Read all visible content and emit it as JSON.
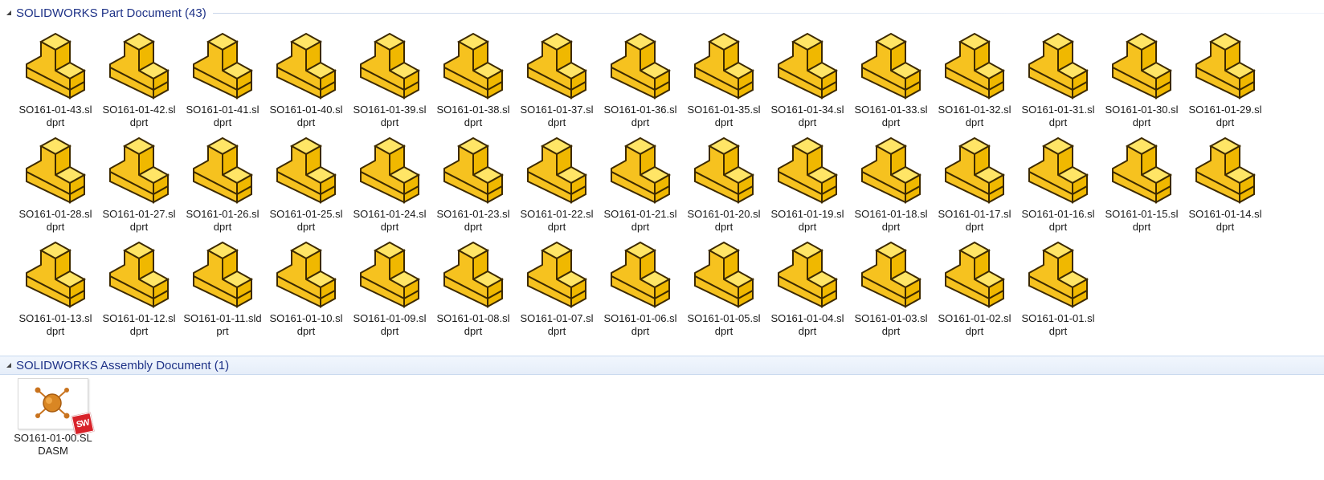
{
  "groups": {
    "part": {
      "title": "SOLIDWORKS Part Document (43)",
      "items": [
        {
          "name": "SO161-01-43.sldprt"
        },
        {
          "name": "SO161-01-42.sldprt"
        },
        {
          "name": "SO161-01-41.sldprt"
        },
        {
          "name": "SO161-01-40.sldprt"
        },
        {
          "name": "SO161-01-39.sldprt"
        },
        {
          "name": "SO161-01-38.sldprt"
        },
        {
          "name": "SO161-01-37.sldprt"
        },
        {
          "name": "SO161-01-36.sldprt"
        },
        {
          "name": "SO161-01-35.sldprt"
        },
        {
          "name": "SO161-01-34.sldprt"
        },
        {
          "name": "SO161-01-33.sldprt"
        },
        {
          "name": "SO161-01-32.sldprt"
        },
        {
          "name": "SO161-01-31.sldprt"
        },
        {
          "name": "SO161-01-30.sldprt"
        },
        {
          "name": "SO161-01-29.sldprt"
        },
        {
          "name": "SO161-01-28.sldprt"
        },
        {
          "name": "SO161-01-27.sldprt"
        },
        {
          "name": "SO161-01-26.sldprt"
        },
        {
          "name": "SO161-01-25.sldprt"
        },
        {
          "name": "SO161-01-24.sldprt"
        },
        {
          "name": "SO161-01-23.sldprt"
        },
        {
          "name": "SO161-01-22.sldprt"
        },
        {
          "name": "SO161-01-21.sldprt"
        },
        {
          "name": "SO161-01-20.sldprt"
        },
        {
          "name": "SO161-01-19.sldprt"
        },
        {
          "name": "SO161-01-18.sldprt"
        },
        {
          "name": "SO161-01-17.sldprt"
        },
        {
          "name": "SO161-01-16.sldprt"
        },
        {
          "name": "SO161-01-15.sldprt"
        },
        {
          "name": "SO161-01-14.sldprt"
        },
        {
          "name": "SO161-01-13.sldprt"
        },
        {
          "name": "SO161-01-12.sldprt"
        },
        {
          "name": "SO161-01-11.sldprt"
        },
        {
          "name": "SO161-01-10.sldprt"
        },
        {
          "name": "SO161-01-09.sldprt"
        },
        {
          "name": "SO161-01-08.sldprt"
        },
        {
          "name": "SO161-01-07.sldprt"
        },
        {
          "name": "SO161-01-06.sldprt"
        },
        {
          "name": "SO161-01-05.sldprt"
        },
        {
          "name": "SO161-01-04.sldprt"
        },
        {
          "name": "SO161-01-03.sldprt"
        },
        {
          "name": "SO161-01-02.sldprt"
        },
        {
          "name": "SO161-01-01.sldprt"
        }
      ]
    },
    "assembly": {
      "title": "SOLIDWORKS Assembly Document (1)",
      "items": [
        {
          "name": "SO161-01-00.SLDASM"
        }
      ]
    }
  },
  "icons": {
    "part": "solidworks-part-icon",
    "assembly": "solidworks-assembly-icon",
    "caret": "collapse-caret-icon"
  },
  "colors": {
    "group_title": "#1e3287",
    "part_face_top": "#ffe566",
    "part_face_front": "#f6c21f",
    "part_face_side": "#f0b800",
    "part_outline": "#3d2a00",
    "sw_logo_red": "#d8232a"
  }
}
